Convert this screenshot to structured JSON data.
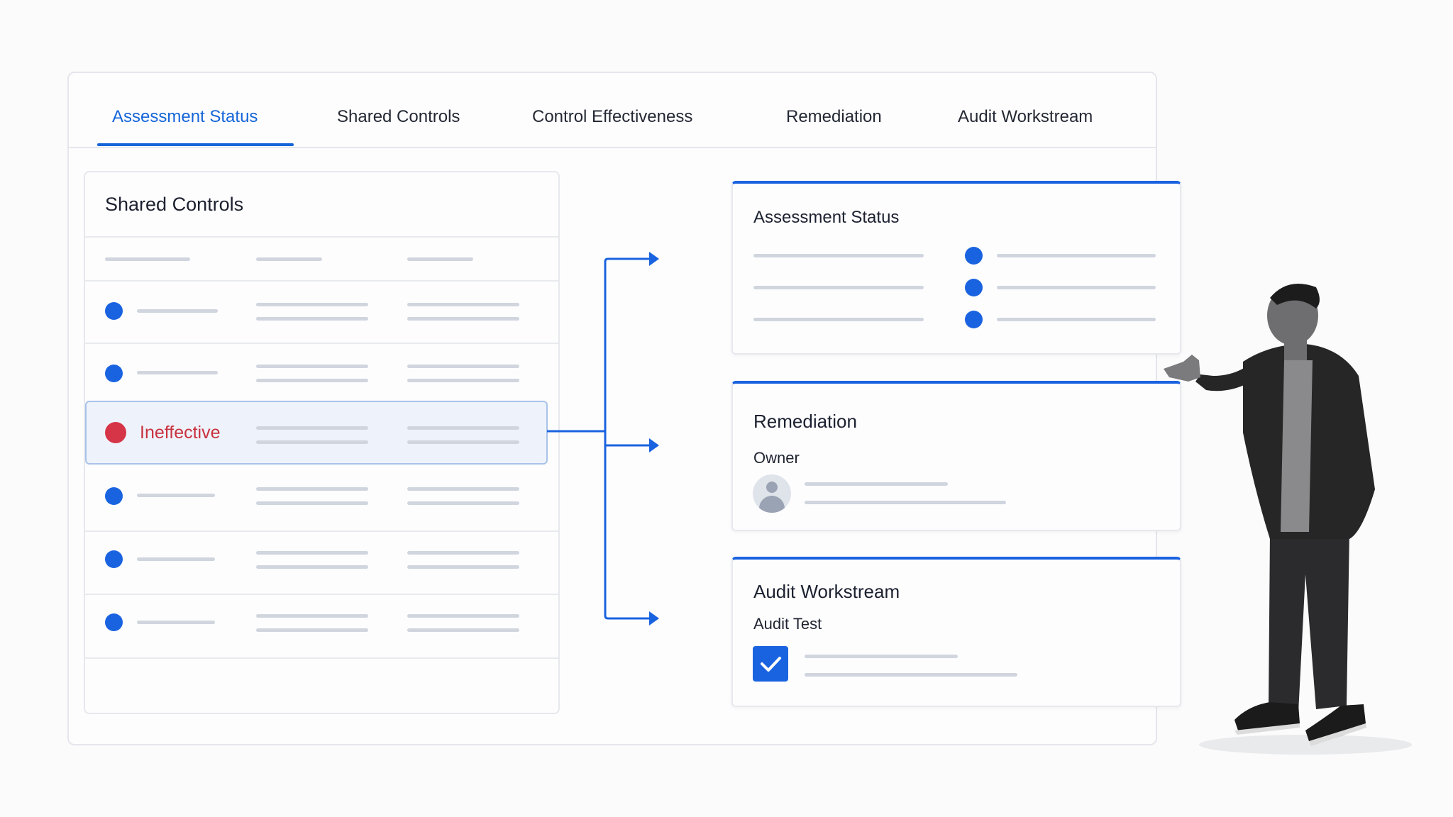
{
  "tabs": [
    {
      "label": "Assessment Status",
      "active": true
    },
    {
      "label": "Shared Controls",
      "active": false
    },
    {
      "label": "Control Effectiveness",
      "active": false
    },
    {
      "label": "Remediation",
      "active": false
    },
    {
      "label": "Audit Workstream",
      "active": false
    }
  ],
  "shared_controls": {
    "title": "Shared Controls",
    "highlight_label": "Ineffective"
  },
  "cards": {
    "assessment": {
      "title": "Assessment Status"
    },
    "remediation": {
      "title": "Remediation",
      "owner_label": "Owner"
    },
    "audit": {
      "title": "Audit Workstream",
      "test_label": "Audit Test",
      "checked": true
    }
  },
  "colors": {
    "accent": "#1565d8",
    "status_ok": "#1a63e0",
    "status_ineffective": "#d63548",
    "placeholder": "#d0d5de"
  },
  "icons": [
    "status-dot-icon",
    "user-avatar-icon",
    "checkmark-icon",
    "arrow-right-icon"
  ]
}
